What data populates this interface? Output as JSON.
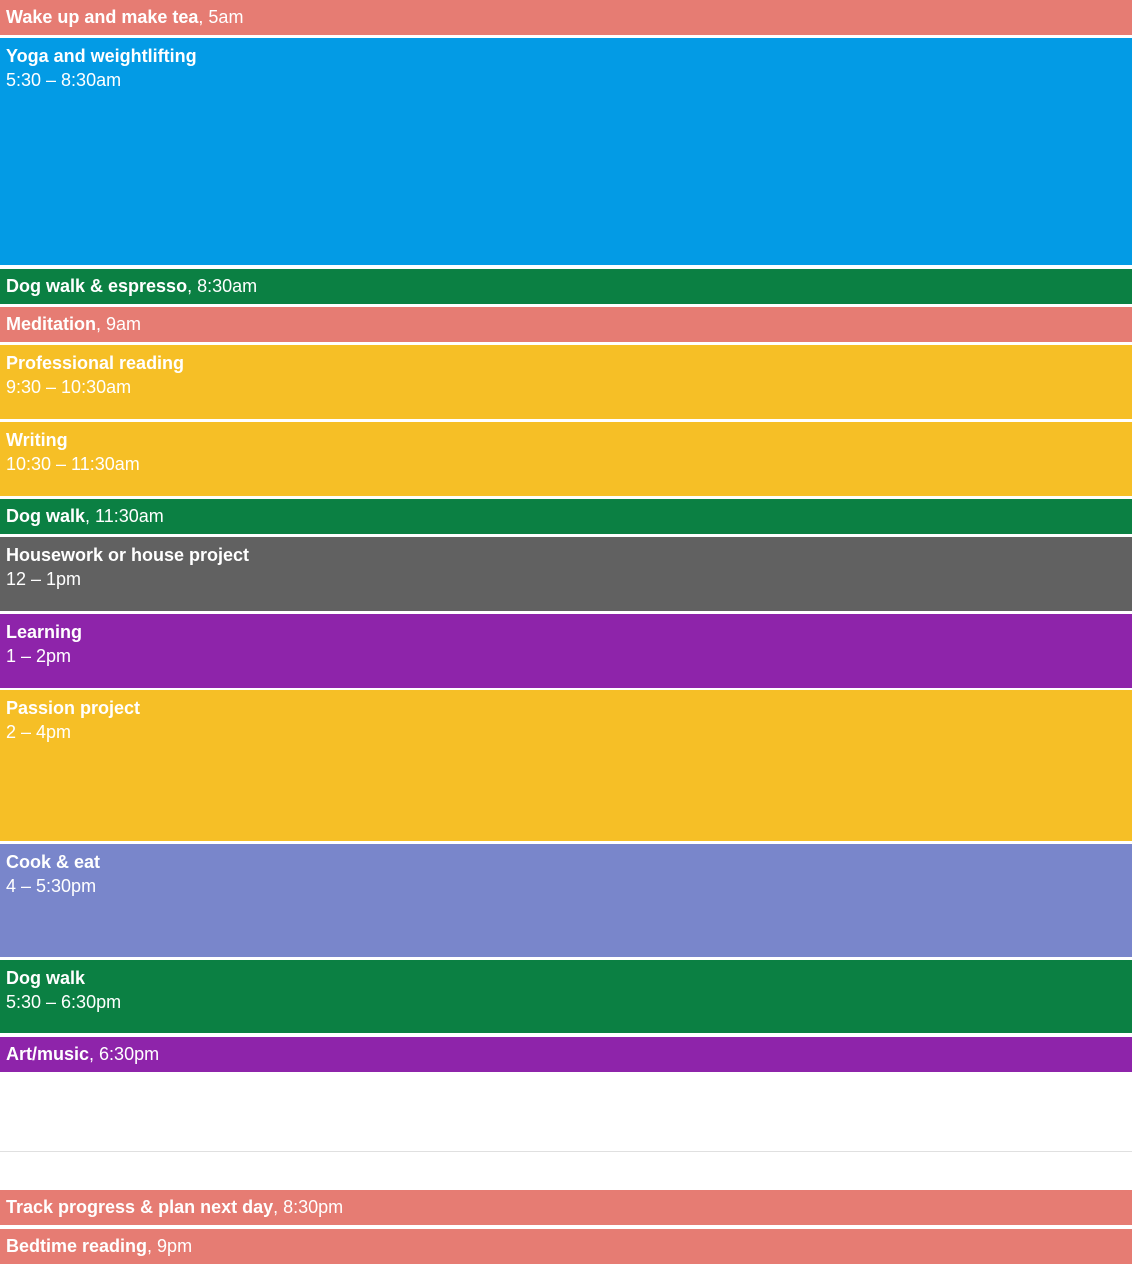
{
  "events": [
    {
      "title": "Wake up and make tea",
      "sep": ", ",
      "time": "5am",
      "color": "#e67c73"
    },
    {
      "title": "Yoga and weightlifting",
      "time": "5:30 – 8:30am",
      "color": "#039be5"
    },
    {
      "title": "Dog walk & espresso",
      "sep": ", ",
      "time": "8:30am",
      "color": "#0b8043"
    },
    {
      "title": "Meditation",
      "sep": ", ",
      "time": "9am",
      "color": "#e67c73"
    },
    {
      "title": "Professional reading",
      "time": "9:30 – 10:30am",
      "color": "#f6bf26"
    },
    {
      "title": "Writing",
      "time": "10:30 – 11:30am",
      "color": "#f6bf26"
    },
    {
      "title": "Dog walk",
      "sep": ", ",
      "time": "11:30am",
      "color": "#0b8043"
    },
    {
      "title": "Housework or house project",
      "time": "12 – 1pm",
      "color": "#616161"
    },
    {
      "title": "Learning",
      "time": "1 – 2pm",
      "color": "#8e24aa"
    },
    {
      "title": "Passion project",
      "time": "2 – 4pm",
      "color": "#f6bf26"
    },
    {
      "title": "Cook & eat",
      "time": "4 – 5:30pm",
      "color": "#7986cb"
    },
    {
      "title": "Dog walk",
      "time": "5:30 – 6:30pm",
      "color": "#0b8043"
    },
    {
      "title": "Art/music",
      "sep": ", ",
      "time": "6:30pm",
      "color": "#8e24aa"
    },
    {
      "title": "Track progress & plan next day",
      "sep": ", ",
      "time": "8:30pm",
      "color": "#e67c73"
    },
    {
      "title": "Bedtime reading",
      "sep": ", ",
      "time": "9pm",
      "color": "#e67c73"
    }
  ]
}
